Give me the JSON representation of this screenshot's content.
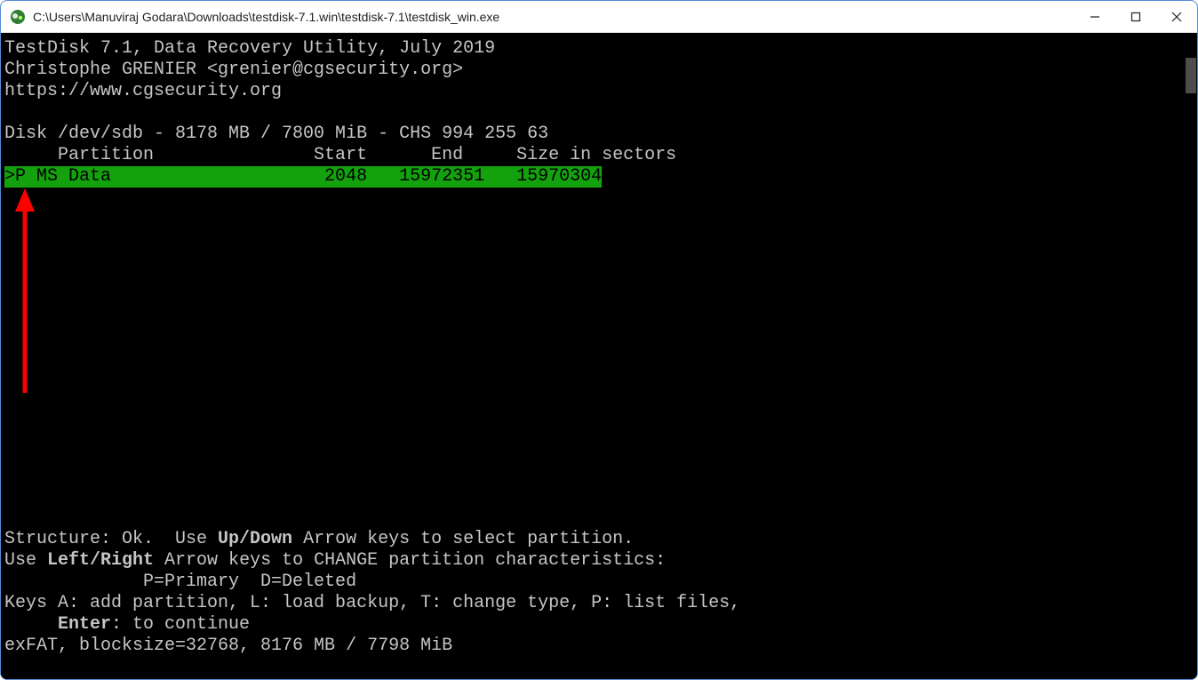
{
  "titlebar": {
    "title": "C:\\Users\\Manuviraj Godara\\Downloads\\testdisk-7.1.win\\testdisk-7.1\\testdisk_win.exe"
  },
  "header": {
    "line1": "TestDisk 7.1, Data Recovery Utility, July 2019",
    "line2": "Christophe GRENIER <grenier@cgsecurity.org>",
    "line3": "https://www.cgsecurity.org"
  },
  "disk_line": "Disk /dev/sdb - 8178 MB / 7800 MiB - CHS 994 255 63",
  "columns": "     Partition               Start      End     Size in sectors",
  "partition_row": ">P MS Data                    2048   15972351   15970304",
  "footer": {
    "structure_text_pre": "Structure: Ok.  Use ",
    "updown": "Up/Down",
    "structure_text_post": " Arrow keys to select partition.",
    "change_pre": "Use ",
    "leftright": "Left/Right",
    "change_post": " Arrow keys to CHANGE partition characteristics:",
    "legend": "             P=Primary  D=Deleted",
    "keys_line": "Keys A: add partition, L: load backup, T: change type, P: list files,",
    "enter_pre": "     ",
    "enter": "Enter",
    "enter_post": ": to continue",
    "fs_line": "exFAT, blocksize=32768, 8176 MB / 7798 MiB"
  },
  "colors": {
    "highlight_bg": "#13a10e",
    "arrow": "#ff0000"
  }
}
